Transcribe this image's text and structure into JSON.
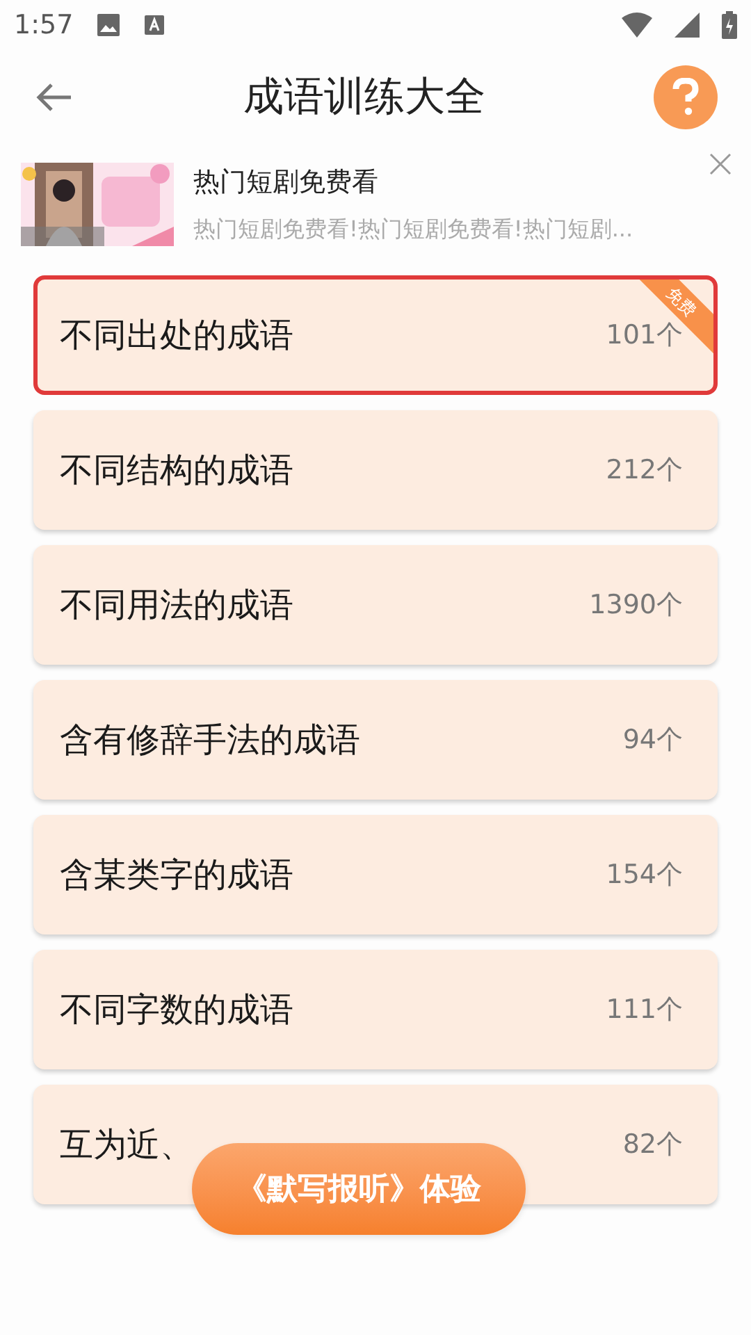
{
  "status_bar": {
    "time": "1:57"
  },
  "header": {
    "title": "成语训练大全"
  },
  "ad": {
    "title": "热门短剧免费看",
    "description": "热门短剧免费看!热门短剧免费看!热门短剧..."
  },
  "categories": [
    {
      "name": "不同出处的成语",
      "count": "101个",
      "selected": true,
      "badge": "免费"
    },
    {
      "name": "不同结构的成语",
      "count": "212个",
      "selected": false
    },
    {
      "name": "不同用法的成语",
      "count": "1390个",
      "selected": false
    },
    {
      "name": "含有修辞手法的成语",
      "count": "94个",
      "selected": false
    },
    {
      "name": "含某类字的成语",
      "count": "154个",
      "selected": false
    },
    {
      "name": "不同字数的成语",
      "count": "111个",
      "selected": false
    },
    {
      "name": "互为近、",
      "count": "82个",
      "selected": false
    }
  ],
  "floating_button": {
    "label": "《默写报听》体验"
  }
}
